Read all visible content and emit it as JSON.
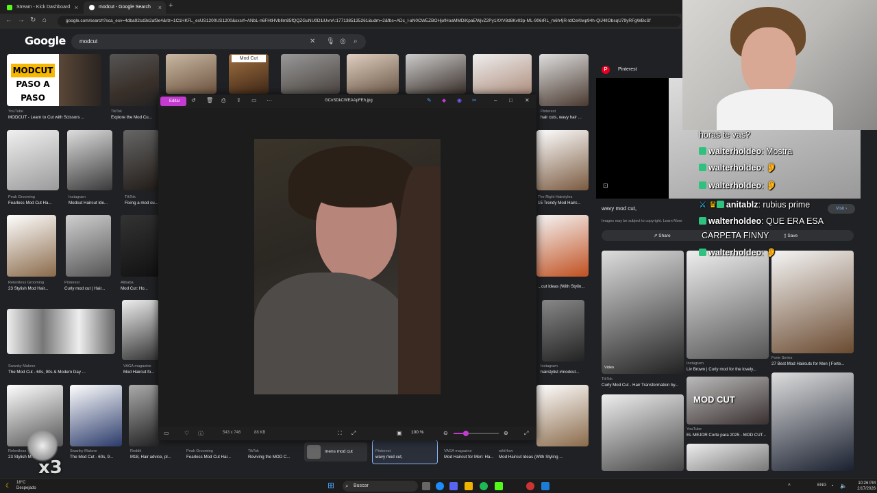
{
  "browser": {
    "tabs": [
      {
        "label": "Stream - Kick Dashboard",
        "fav_color": "#53fc18"
      },
      {
        "label": "modcut - Google Search",
        "fav_color": "#ffffff"
      }
    ],
    "url": "google.com/search?sca_esv=4dba92cd3e2af3e4&rlz=1C1HKFL_esUS1200US1200&sxsrf=ANbL-n6FHtHVbIlm85fQQZGuNU0D1iUvnA:1771385135261&udm=2&fbs=ADc_l-aN0CWEZBOHjofHoaMMDiKpaEWjvZ2Py1XXV8d8KvlI3p-ML-906rRL_m6h4jR-tdCeKlwp94h-QiJ4lIObsqU79yRFgWBcSf",
    "newtab": "+"
  },
  "google": {
    "logo": "Google",
    "query": "modcut"
  },
  "grid": {
    "row1": [
      {
        "src": "YouTube",
        "title": "MODCUT - Learn to Cut with Scissors ...",
        "thumb_text": "MODCUT PASO A PASO"
      },
      {
        "src": "TikTok",
        "title": "Explore the Mod Cu..."
      },
      {
        "mod_label": "Mod Cut"
      }
    ],
    "row2": [
      {
        "src": "Peak Grooming",
        "title": "Fearless Mod Cut Ha..."
      },
      {
        "src": "Instagram",
        "title": "Modcut Haircut Ide..."
      },
      {
        "src": "TikTok",
        "title": "Fixing a mod cu..."
      }
    ],
    "row3": [
      {
        "src": "Relentless Grooming",
        "title": "23 Stylish Mod Hair..."
      },
      {
        "src": "Pinterest",
        "title": "Curly mod cut | Hair..."
      },
      {
        "src": "Alibaba",
        "title": "Mod Cut: Ho..."
      }
    ],
    "row4": [
      {
        "src": "Swanky Malone",
        "title": "The Mod Cut - 60s, 90s & Modern Day ..."
      },
      {
        "src": "VAGA magazine",
        "title": "Mod Haircut fo..."
      }
    ],
    "row5": [
      {
        "src": "Relentless",
        "title": "23 Stylish M..."
      },
      {
        "src": "Swanky Malone",
        "title": "The Mod Cut - 60s, 9..."
      },
      {
        "src": "Reddit",
        "title": "M18, Hair advice, pl..."
      },
      {
        "src": "Peak Grooming",
        "title": "Fearless Mod Cut Hai..."
      },
      {
        "src": "TikTok",
        "title": "Reviving the MOD C..."
      },
      {
        "src": "Pinterest",
        "title": "wavy mod cut,"
      },
      {
        "src": "VAGA magazine",
        "title": "Mod Haircut for Men: Ha..."
      },
      {
        "src": "wikiHow",
        "title": "Mod Haircut Ideas (With Styling ..."
      }
    ],
    "right_col": [
      {
        "src": "Pinterest",
        "title": "hair cuts, wavy hair ..."
      },
      {
        "src": "The Right Hairstyles",
        "title": "15 Trendy Mod Hairc..."
      },
      {
        "src": "",
        "title": "...cut Ideas (With Stylin..."
      },
      {
        "src": "Instagram",
        "title": "hairstylist #modcut..."
      }
    ],
    "related_chip": "mens mod cut"
  },
  "viewer": {
    "edit_label": "Editar",
    "filename": "GCnSDkCWEAApFEh.jpg",
    "dimensions": "543 x 746",
    "filesize": "88 KB",
    "zoom": "100 %",
    "zoom_level": 0.27
  },
  "panel": {
    "source": "Pinterest",
    "title": "wavy mod cut,",
    "copyright": "Images may be subject to copyright. Learn More",
    "visit": "Visit",
    "share": "Share",
    "save": "Save",
    "results": [
      {
        "src": "TikTok",
        "title": "Curly Mod Cut - Hair Transformation by..."
      },
      {
        "src": "Instagram",
        "title": "Liv Brown | Curly mod for the lovely..."
      },
      {
        "src": "Forte Series",
        "title": "27 Best Mod Haircuts for Men | Forte..."
      },
      {
        "src": "YouTube",
        "title": "EL MEJOR Corte para 2025 - MOD CUT..."
      }
    ],
    "modcut_overlay": "MOD CUT",
    "video_label": "Video"
  },
  "chat": {
    "lines": [
      {
        "user": "",
        "text": "horas te vas?"
      },
      {
        "user": "walterholdeo",
        "text": ": Mostra"
      },
      {
        "user": "walterholdeo",
        "text": ": 👂"
      },
      {
        "user": "walterholdeo",
        "text": ": 👂"
      },
      {
        "user": "anitablz",
        "text": ": rubius prime"
      },
      {
        "user": "walterholdeo",
        "text": ": QUE ERA ESA"
      },
      {
        "user": "",
        "text": "CARPETA FINNY"
      },
      {
        "user": "walterholdeo",
        "text": ": 👂"
      }
    ]
  },
  "overlay": {
    "multiplier": "x3"
  },
  "taskbar": {
    "weather_temp": "18°C",
    "weather_desc": "Despejado",
    "search": "Buscar",
    "lang": "ENG",
    "time": "10:26 PM",
    "date": "2/17/2026"
  },
  "colors": {
    "accent": "#c43bd1",
    "pinterest": "#e60023",
    "kick": "#53fc18"
  }
}
